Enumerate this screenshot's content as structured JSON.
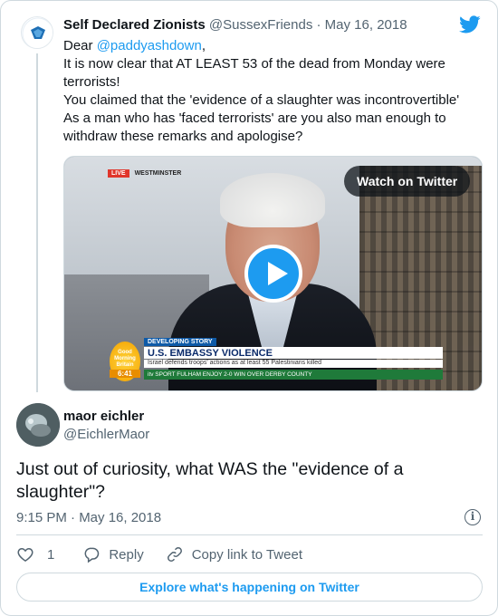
{
  "quoted_tweet": {
    "author_name": "Self Declared Zionists",
    "author_handle": "@SussexFriends",
    "separator": "·",
    "date": "May 16, 2018",
    "text_lines": [
      {
        "prefix": "Dear ",
        "mention": "@paddyashdown",
        "suffix": ","
      },
      "It is now clear that AT LEAST 53 of the dead from Monday were terrorists!",
      "You claimed that the 'evidence of a slaughter was incontrovertible'",
      "As a man who has 'faced terrorists' are you also man enough to withdraw these remarks and apologise?"
    ],
    "media": {
      "watch_label": "Watch on Twitter",
      "live_label": "LIVE",
      "location": "WESTMINSTER",
      "developing_label": "DEVELOPING STORY",
      "headline": "U.S. EMBASSY VIOLENCE",
      "subline": "Israel defends troops' actions as at least 55 Palestinians killed",
      "show_logo": "Good Morning Britain",
      "clock": "6:41",
      "sport_ticker": "itv SPORT   FULHAM ENJOY 2-0 WIN OVER DERBY COUNTY"
    }
  },
  "tweet": {
    "author_name": "maor eichler",
    "author_handle": "@EichlerMaor",
    "text": "Just out of curiosity, what WAS the \"evidence of a slaughter\"?",
    "timestamp": "9:15 PM · May 16, 2018"
  },
  "actions": {
    "like_count": "1",
    "reply_label": "Reply",
    "copy_label": "Copy link to Tweet"
  },
  "explore_label": "Explore what's happening on Twitter",
  "colors": {
    "accent": "#1d9bf0",
    "text": "#0f1419",
    "secondary": "#536471",
    "border": "#cfd9de"
  }
}
